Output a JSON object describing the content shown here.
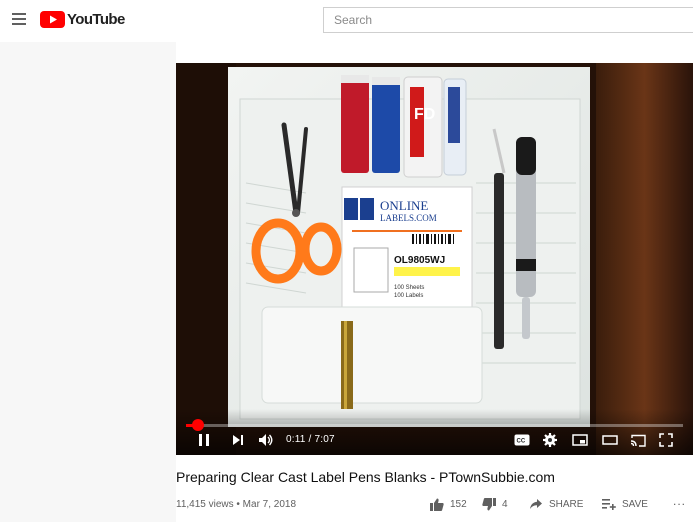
{
  "header": {
    "logo_text": "YouTube",
    "search_placeholder": "Search"
  },
  "player": {
    "progress": 0.025,
    "time_display": "0:11 / 7:07",
    "props_label": {
      "brand_line1": "ONLINE",
      "brand_line2": "LABELS.COM",
      "sku": "OL9805WJ",
      "sheets": "100 Sheets",
      "labels": "100 Labels"
    }
  },
  "video": {
    "title": "Preparing Clear Cast Label Pens Blanks - PTownSubbie.com",
    "views_date": "11,415 views • Mar 7, 2018"
  },
  "actions": {
    "like_count": "152",
    "dislike_count": "4",
    "share_label": "SHARE",
    "save_label": "SAVE",
    "more_label": "..."
  },
  "colors": {
    "brand_red": "#ff0000",
    "progress_red": "#ff0000",
    "text_primary": "#0f0f0f",
    "text_secondary": "#606060"
  }
}
